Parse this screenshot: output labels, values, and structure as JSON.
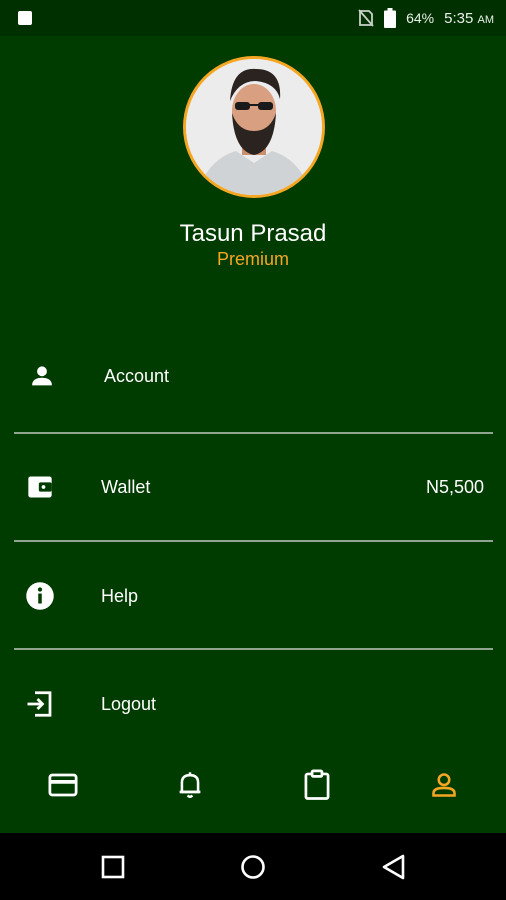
{
  "status_bar": {
    "battery_text": "64%",
    "time": "5:35",
    "time_suffix": "AM"
  },
  "profile": {
    "name": "Tasun Prasad",
    "tier": "Premium"
  },
  "menu": {
    "items": [
      {
        "label": "Account",
        "icon": "person-icon",
        "value": ""
      },
      {
        "label": "Wallet",
        "icon": "wallet-icon",
        "value": "N5,500"
      },
      {
        "label": "Help",
        "icon": "info-icon",
        "value": ""
      },
      {
        "label": "Logout",
        "icon": "logout-icon",
        "value": ""
      }
    ]
  },
  "bottom_nav": {
    "items": [
      {
        "icon": "card-icon",
        "active": false
      },
      {
        "icon": "bell-icon",
        "active": false
      },
      {
        "icon": "clipboard-icon",
        "active": false
      },
      {
        "icon": "profile-icon",
        "active": true
      }
    ]
  },
  "colors": {
    "background": "#003b00",
    "accent": "#f5a623",
    "status_bar": "#003000"
  }
}
